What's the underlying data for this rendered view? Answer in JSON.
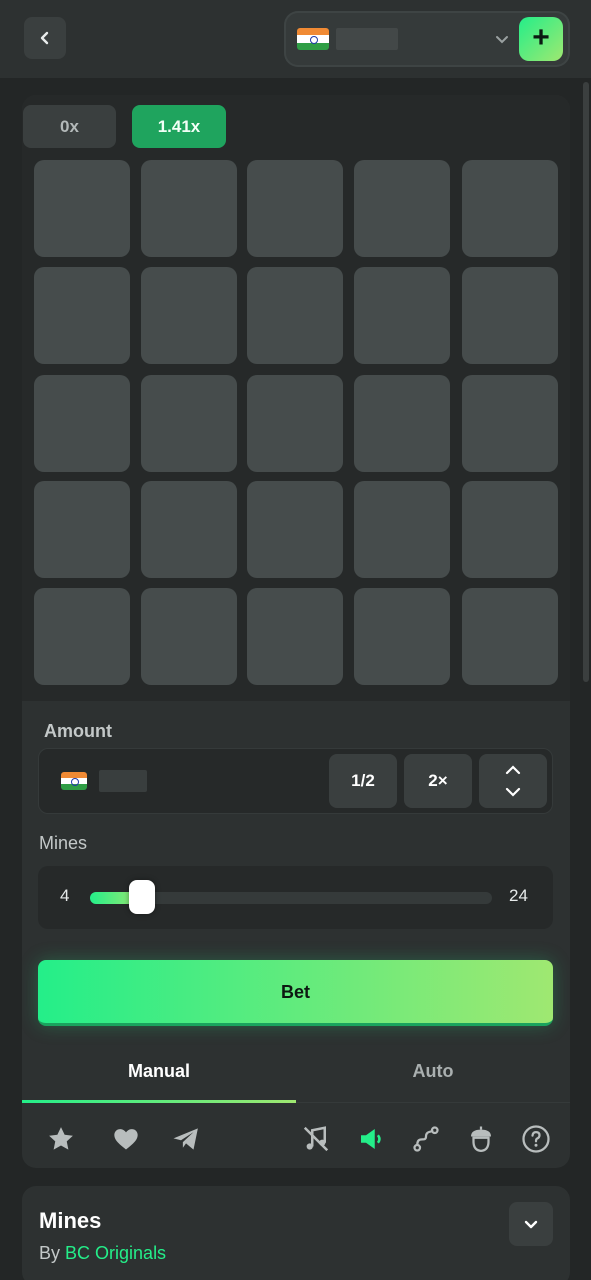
{
  "topbar": {
    "back_icon": "chevron-left-icon",
    "currency_flag": "india-flag",
    "dropdown_icon": "chevron-down-icon",
    "deposit_label": "+"
  },
  "board": {
    "multipliers": [
      "0x",
      "1.41x"
    ],
    "active_multiplier_index": 1,
    "rows": 5,
    "cols": 5
  },
  "amount": {
    "label": "Amount",
    "half_label": "1/2",
    "double_label": "2×"
  },
  "mines": {
    "label": "Mines",
    "value": "4",
    "min": "4",
    "max": "24",
    "slider_fraction": 0.13
  },
  "bet_label": "Bet",
  "tabs": [
    {
      "label": "Manual",
      "active": true
    },
    {
      "label": "Auto",
      "active": false
    }
  ],
  "toolbar_icons": [
    "star-icon",
    "heart-icon",
    "telegram-icon",
    "music-off-icon",
    "sound-on-icon",
    "route-icon",
    "acorn-icon",
    "help-icon"
  ],
  "info": {
    "title": "Mines",
    "by_prefix": "By",
    "provider": "BC Originals"
  },
  "colors": {
    "accent": "#24ee89",
    "accent_end": "#9fe871",
    "background": "#232626",
    "panel": "#2d3131",
    "tile": "#464c4c"
  }
}
